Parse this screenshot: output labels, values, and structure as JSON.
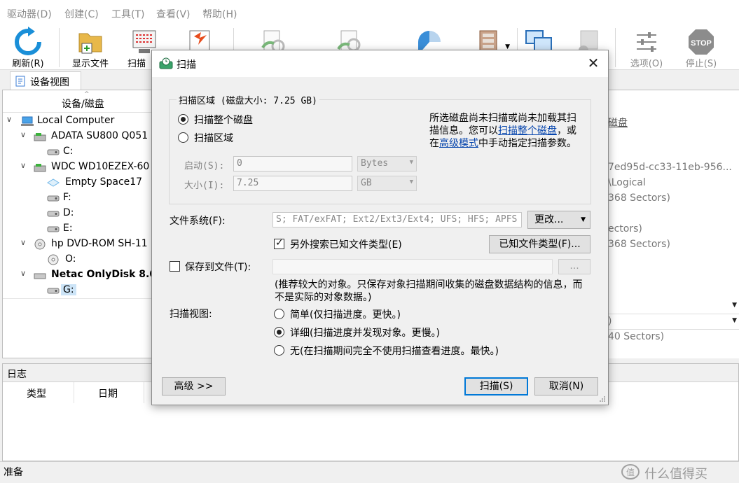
{
  "menu": [
    "驱动器(D)",
    "创建(C)",
    "工具(T)",
    "查看(V)",
    "帮助(H)"
  ],
  "toolbar": {
    "refresh": "刷新(R)",
    "show_files": "显示文件",
    "scan": "扫描",
    "options": "选项(O)",
    "stop": "停止(S)",
    "stop_icon_text": "STOP"
  },
  "tab": {
    "label": "设备视图"
  },
  "tree": {
    "header": "设备/磁盘",
    "rows": [
      {
        "label": "Local Computer"
      },
      {
        "label": "ADATA SU800 Q051"
      },
      {
        "label": "C:"
      },
      {
        "label": "WDC WD10EZEX-60"
      },
      {
        "label": "Empty Space17"
      },
      {
        "label": "F:"
      },
      {
        "label": "D:"
      },
      {
        "label": "E:"
      },
      {
        "label": "hp DVD-ROM SH-11"
      },
      {
        "label": "O:"
      },
      {
        "label": "Netac OnlyDisk 8.0"
      },
      {
        "label": "G:"
      }
    ]
  },
  "right": {
    "header": "磁盘",
    "r1": "7ed95d-cc33-11eb-956...",
    "r2": "\\Logical",
    "r3": "368 Sectors)",
    "r4": "ectors)",
    "r5": "368 Sectors)",
    "r6": ")",
    "r7": "40 Sectors)"
  },
  "log": {
    "title": "日志",
    "col_type": "类型",
    "col_date": "日期"
  },
  "status": {
    "text": "准备"
  },
  "watermark": "什么值得买",
  "dialog": {
    "title": "扫描",
    "close": "✕",
    "group_legend": "扫描区域 (磁盘大小: 7.25 GB)",
    "opt_whole": "扫描整个磁盘",
    "opt_region": "扫描区域",
    "start_label": "启动(S):",
    "start_value": "0",
    "start_unit": "Bytes",
    "size_label": "大小(I):",
    "size_value": "7.25",
    "size_unit": "GB",
    "info_1": "所选磁盘尚未扫描或尚未加载其扫描信息。您可以",
    "info_link1": "扫描整个磁盘",
    "info_2": "，或在",
    "info_link2": "高级模式",
    "info_3": "中手动指定扫描参数。",
    "fs_label": "文件系统(F):",
    "fs_value": "S; FAT/exFAT; Ext2/Ext3/Ext4; UFS; HFS; APFS",
    "change_btn": "更改...",
    "known_check": "另外搜索已知文件类型(E)",
    "known_btn": "已知文件类型(F)...",
    "save_check": "保存到文件(T):",
    "save_path": "",
    "browse_btn": "...",
    "note": "(推荐较大的对象。只保存对象扫描期间收集的磁盘数据结构的信息，而不是实际的对象数据。)",
    "view_label": "扫描视图:",
    "view_simple": "简单(仅扫描进度。更快。)",
    "view_detail": "详细(扫描进度并发现对象。更慢。)",
    "view_none": "无(在扫描期间完全不使用扫描查看进度。最快。)",
    "advanced_btn": "高级 >>",
    "scan_btn": "扫描(S)",
    "cancel_btn": "取消(N)"
  }
}
